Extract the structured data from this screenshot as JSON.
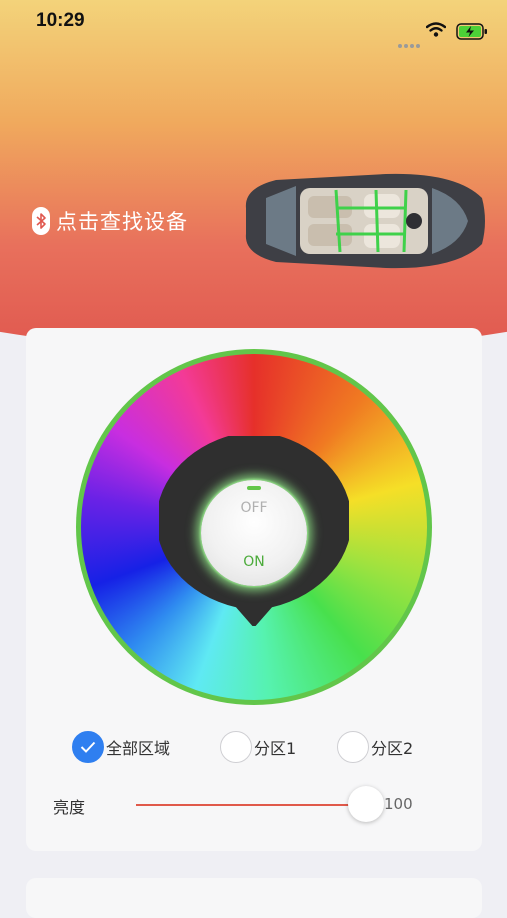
{
  "status_bar": {
    "time": "10:29"
  },
  "header": {
    "bluetooth_label": "点击查找设备"
  },
  "switch": {
    "off_label": "OFF",
    "on_label": "ON"
  },
  "zones": [
    {
      "label": "全部区域",
      "checked": true
    },
    {
      "label": "分区1",
      "checked": false
    },
    {
      "label": "分区2",
      "checked": false
    }
  ],
  "brightness": {
    "label": "亮度",
    "value": "100",
    "level": 1.0
  },
  "colors": {
    "accent_green": "#62c64a",
    "radio_checked": "#2f7ff0",
    "slider_track": "#e0594a",
    "header_top": "#f3d37a",
    "header_bottom": "#e0584f"
  },
  "icons": [
    "wifi-icon",
    "battery-charging-icon",
    "bluetooth-icon",
    "check-icon",
    "car-top-view-image"
  ]
}
